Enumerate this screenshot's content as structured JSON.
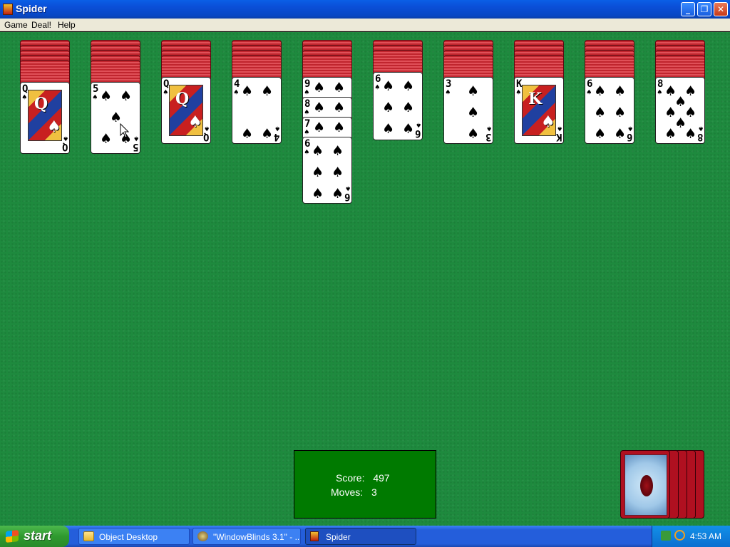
{
  "window": {
    "title": "Spider"
  },
  "menu": {
    "items": [
      "Game",
      "Deal!",
      "Help"
    ]
  },
  "columns": [
    {
      "face_down": 5,
      "face_up": [
        {
          "rank": "Q",
          "suit": "♠",
          "face": true
        }
      ]
    },
    {
      "face_down": 5,
      "face_up": [
        {
          "rank": "5",
          "suit": "♠"
        }
      ]
    },
    {
      "face_down": 4,
      "face_up": [
        {
          "rank": "Q",
          "suit": "♠",
          "face": true
        }
      ]
    },
    {
      "face_down": 4,
      "face_up": [
        {
          "rank": "4",
          "suit": "♠"
        }
      ]
    },
    {
      "face_down": 4,
      "face_up": [
        {
          "rank": "9",
          "suit": "♠"
        },
        {
          "rank": "8",
          "suit": "♠"
        },
        {
          "rank": "7",
          "suit": "♠"
        },
        {
          "rank": "6",
          "suit": "♠"
        }
      ]
    },
    {
      "face_down": 3,
      "face_up": [
        {
          "rank": "6",
          "suit": "♠"
        }
      ]
    },
    {
      "face_down": 4,
      "face_up": [
        {
          "rank": "3",
          "suit": "♠"
        }
      ]
    },
    {
      "face_down": 4,
      "face_up": [
        {
          "rank": "K",
          "suit": "♠",
          "face": true
        }
      ]
    },
    {
      "face_down": 4,
      "face_up": [
        {
          "rank": "6",
          "suit": "♠"
        }
      ]
    },
    {
      "face_down": 4,
      "face_up": [
        {
          "rank": "8",
          "suit": "♠"
        }
      ]
    }
  ],
  "score": {
    "score_label": "Score:",
    "score_value": "497",
    "moves_label": "Moves:",
    "moves_value": "3"
  },
  "stock": {
    "deals_remaining": 5
  },
  "taskbar": {
    "start_label": "start",
    "items": [
      {
        "label": "Object Desktop",
        "icon": "folder-icon",
        "active": false
      },
      {
        "label": "\"WindowBlinds 3.1\" - ...",
        "icon": "windowblinds-icon",
        "active": false
      },
      {
        "label": "Spider",
        "icon": "spider-app-icon",
        "active": true
      }
    ],
    "clock": "4:53 AM"
  },
  "colors": {
    "table_green": "#1e8a3e",
    "card_back_red": "#c0252e",
    "score_box": "#007a00",
    "taskbar_blue": "#245edb"
  }
}
